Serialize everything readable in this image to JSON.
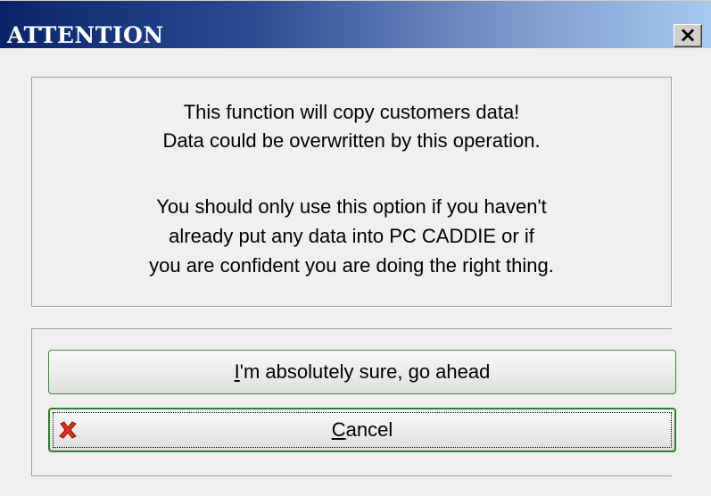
{
  "window": {
    "title": "ATTENTION",
    "close_glyph": "✕"
  },
  "message": {
    "line1": "This function will copy customers data!",
    "line2": "Data could be overwritten by this operation.",
    "line3": "You should only use this option if you haven't",
    "line4": "already put any data into PC CADDIE or if",
    "line5": "you are confident you are doing the right thing."
  },
  "buttons": {
    "confirm_mnemonic": "I",
    "confirm_rest": "'m absolutely sure, go ahead",
    "cancel_mnemonic": "C",
    "cancel_rest": "ancel",
    "cancel_icon": "red-x-icon"
  },
  "colors": {
    "title_gradient_start": "#0a246a",
    "title_gradient_end": "#a6caf0",
    "button_border": "#3c8c3c",
    "cancel_icon": "#e03020"
  }
}
